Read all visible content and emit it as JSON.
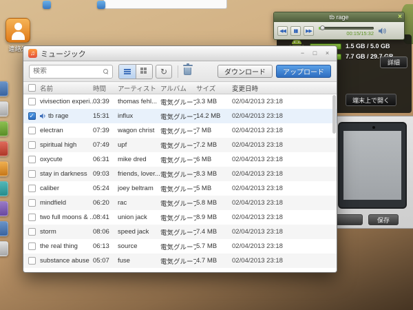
{
  "desktop": {
    "contact_label": "連絡先"
  },
  "icons": {
    "prev": "◀◀",
    "pause": "▮▮",
    "next": "▶▶",
    "close": "×",
    "minimize": "−",
    "maximize": "□",
    "window_close": "×",
    "refresh": "↻",
    "music_note": "♫"
  },
  "mini_player": {
    "title": "tb rage",
    "time": "00:15/15:32",
    "progress_percent": 4
  },
  "device_panel": {
    "storage_internal": "1.5 GB / 5.0 GB",
    "storage_sd": "7.7 GB / 29.7 GB",
    "details_button": "詳細",
    "open_on_device_button": "端末上で開く"
  },
  "preview_window": {
    "save_button": "保存"
  },
  "music_window": {
    "title": "ミュージック",
    "search_placeholder": "検索",
    "download_button": "ダウンロード",
    "upload_button": "アップロード",
    "columns": [
      "名前",
      "時間",
      "アーティスト",
      "アルバム",
      "サイズ",
      "変更日時"
    ],
    "rows": [
      {
        "name": "vivisection experi...",
        "time": "03:39",
        "artist": "thomas fehl...",
        "album": "電気グループのデ...",
        "size": "3.3 MB",
        "date": "02/04/2013 23:18",
        "checked": false,
        "playing": false
      },
      {
        "name": "tb rage",
        "time": "15:31",
        "artist": "influx",
        "album": "電気グループのデ...",
        "size": "14.2 MB",
        "date": "02/04/2013 23:18",
        "checked": true,
        "playing": true
      },
      {
        "name": "electran",
        "time": "07:39",
        "artist": "wagon christ",
        "album": "電気グループのデ...",
        "size": "7 MB",
        "date": "02/04/2013 23:18",
        "checked": false,
        "playing": false
      },
      {
        "name": "spiritual high",
        "time": "07:49",
        "artist": "upf",
        "album": "電気グループのデ...",
        "size": "7.2 MB",
        "date": "02/04/2013 23:18",
        "checked": false,
        "playing": false
      },
      {
        "name": "oxycute",
        "time": "06:31",
        "artist": "mike dred",
        "album": "電気グループのデ...",
        "size": "6 MB",
        "date": "02/04/2013 23:18",
        "checked": false,
        "playing": false
      },
      {
        "name": "stay in darkness",
        "time": "09:03",
        "artist": "friends, lover...",
        "album": "電気グループのデ...",
        "size": "8.3 MB",
        "date": "02/04/2013 23:18",
        "checked": false,
        "playing": false
      },
      {
        "name": "caliber",
        "time": "05:24",
        "artist": "joey beltram",
        "album": "電気グループのデ...",
        "size": "5 MB",
        "date": "02/04/2013 23:18",
        "checked": false,
        "playing": false
      },
      {
        "name": "mindfield",
        "time": "06:20",
        "artist": "rac",
        "album": "電気グループのデ...",
        "size": "5.8 MB",
        "date": "02/04/2013 23:18",
        "checked": false,
        "playing": false
      },
      {
        "name": "two full moons & ...",
        "time": "08:41",
        "artist": "union jack",
        "album": "電気グループのデ...",
        "size": "8.9 MB",
        "date": "02/04/2013 23:18",
        "checked": false,
        "playing": false
      },
      {
        "name": "storm",
        "time": "08:06",
        "artist": "speed jack",
        "album": "電気グループのデ...",
        "size": "7.4 MB",
        "date": "02/04/2013 23:18",
        "checked": false,
        "playing": false
      },
      {
        "name": "the real thing",
        "time": "06:13",
        "artist": "source",
        "album": "電気グループのデ...",
        "size": "5.7 MB",
        "date": "02/04/2013 23:18",
        "checked": false,
        "playing": false
      },
      {
        "name": "substance abuse",
        "time": "05:07",
        "artist": "fuse",
        "album": "電気グループのデ...",
        "size": "4.7 MB",
        "date": "02/04/2013 23:18",
        "checked": false,
        "playing": false
      }
    ]
  },
  "colors": {
    "accent_blue": "#2e6ec0",
    "player_green": "#7cc243",
    "storage_green": "#8cc63f"
  }
}
